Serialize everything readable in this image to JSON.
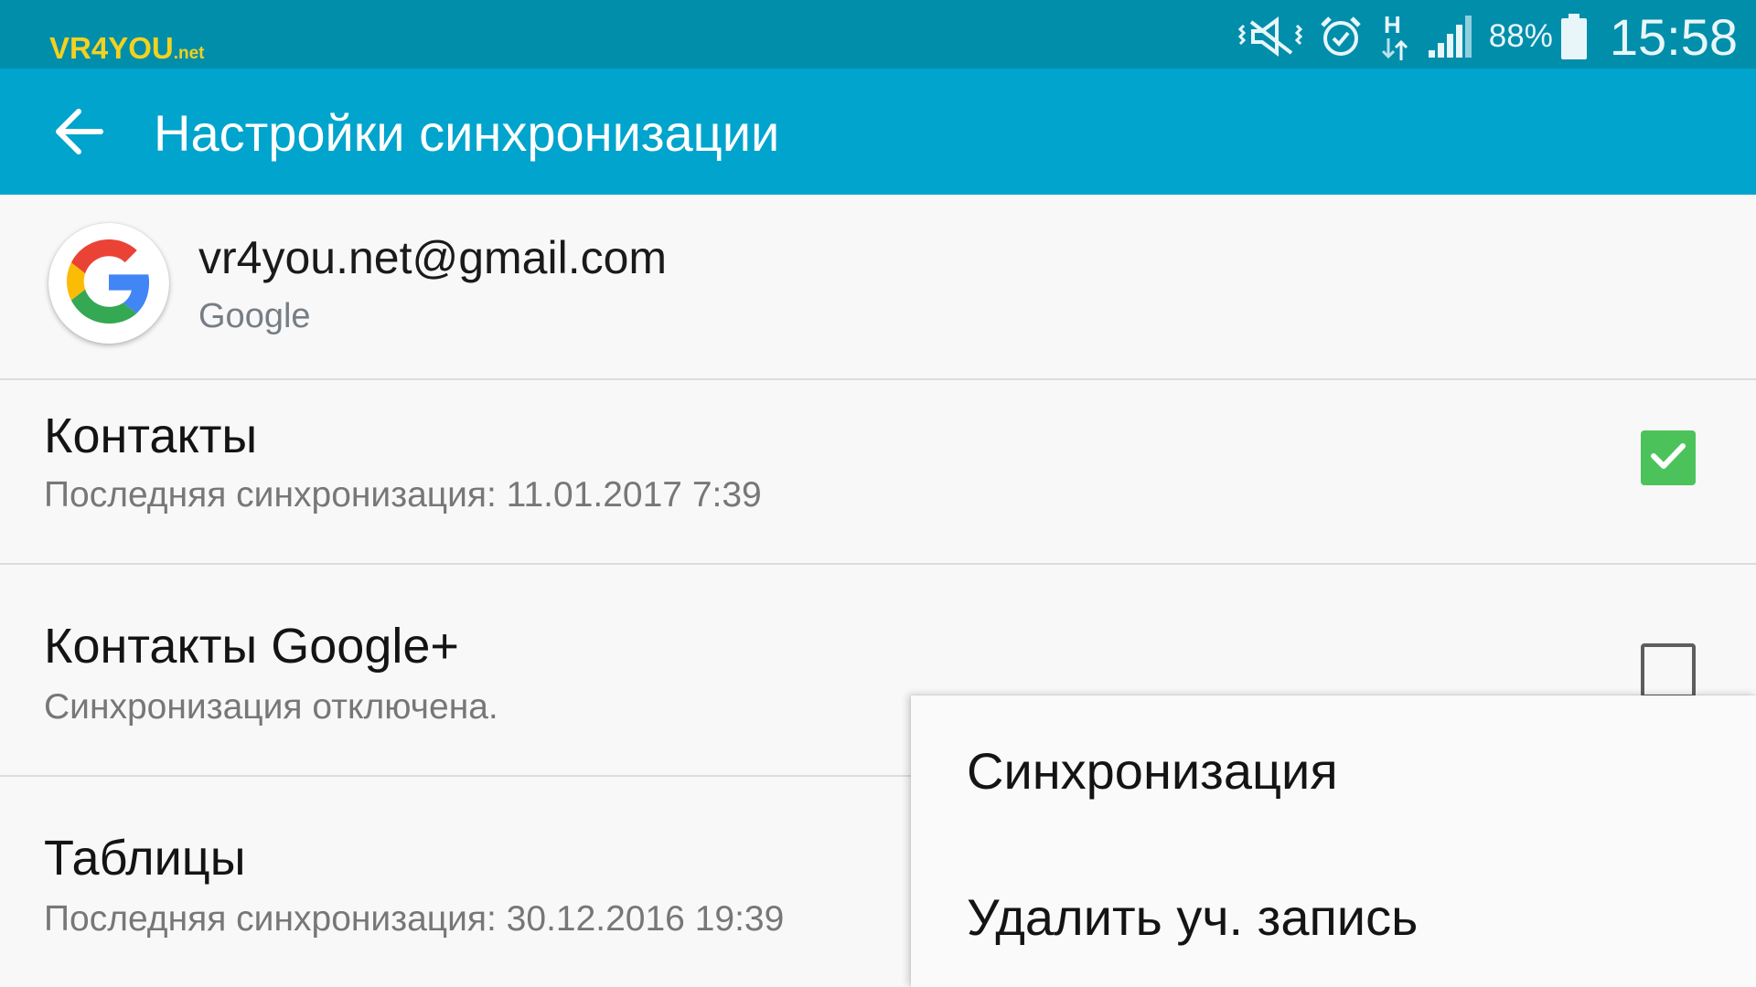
{
  "watermark": {
    "main": "VR4YOU",
    "suffix": ".net"
  },
  "status_bar": {
    "icons": [
      "vibrate-mute-icon",
      "alarm-icon",
      "network-h-icon",
      "signal-icon",
      "battery-icon"
    ],
    "battery_percent": "88%",
    "time": "15:58"
  },
  "app_bar": {
    "back_icon": "arrow-back-icon",
    "title": "Настройки синхронизации",
    "color": "#00a4cc"
  },
  "account": {
    "email": "vr4you.net@gmail.com",
    "type": "Google",
    "avatar_icon": "google-g-icon"
  },
  "sync_items": [
    {
      "title": "Контакты",
      "subtitle": "Последняя синхронизация: 11.01.2017 7:39",
      "checked": true
    },
    {
      "title": "Контакты Google+",
      "subtitle": "Синхронизация отключена.",
      "checked": false
    },
    {
      "title": "Таблицы",
      "subtitle": "Последняя синхронизация: 30.12.2016 19:39"
    }
  ],
  "menu": {
    "items": [
      {
        "label": "Синхронизация"
      },
      {
        "label": "Удалить уч. запись"
      }
    ]
  },
  "colors": {
    "status_bar": "#008eab",
    "checkbox_on": "#4cc35a"
  }
}
